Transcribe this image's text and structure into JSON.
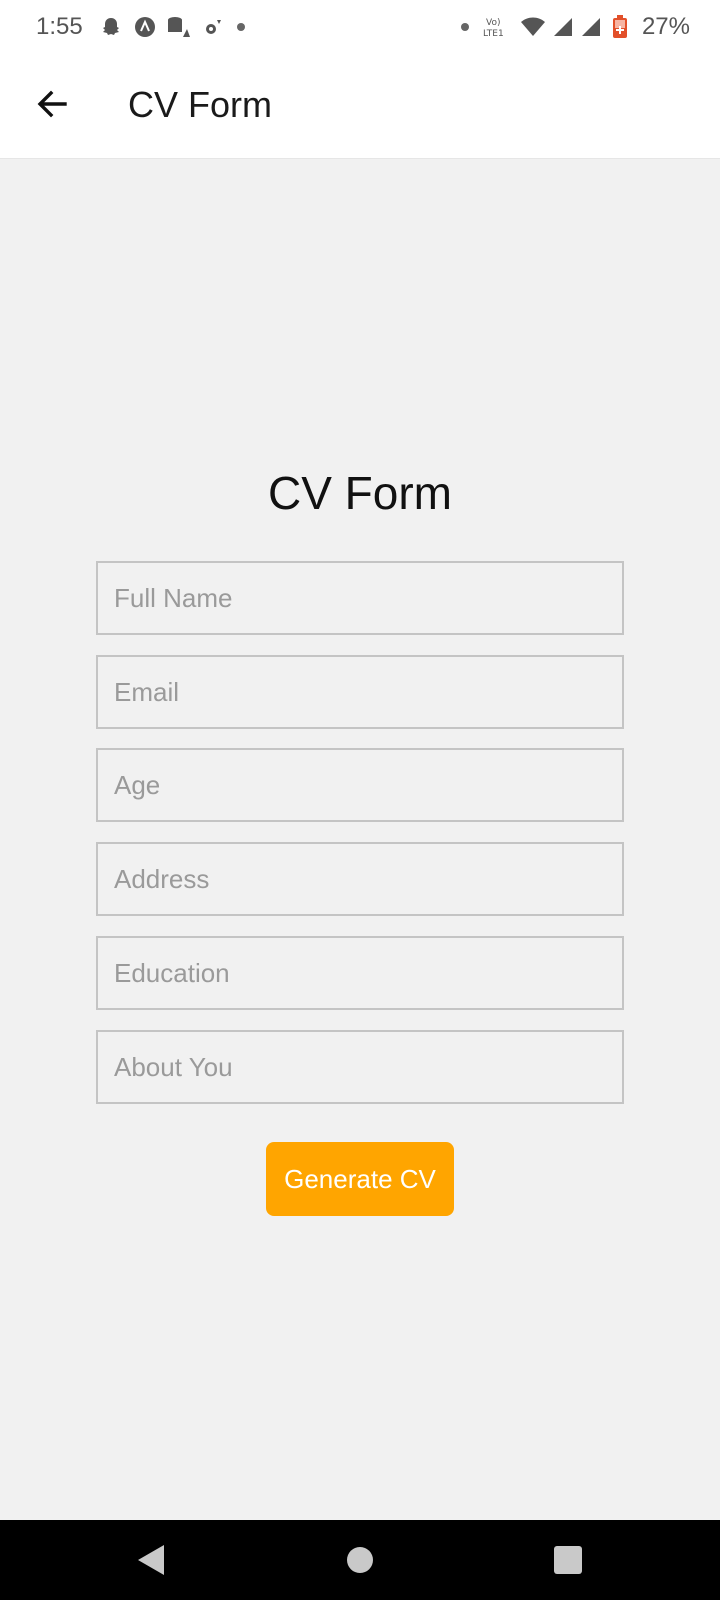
{
  "status_bar": {
    "time": "1:55",
    "battery": "27%",
    "icons": [
      "snapchat-icon",
      "autofill-icon",
      "data-warning-icon",
      "settings-dot-icon",
      "notification-dot-icon",
      "dot-icon",
      "volte-icon",
      "wifi-icon",
      "signal-icon",
      "signal-icon",
      "battery-icon"
    ]
  },
  "app_bar": {
    "title": "CV Form",
    "back_icon": "arrow-back-icon"
  },
  "form": {
    "title": "CV Form",
    "fields": {
      "full_name": {
        "placeholder": "Full Name",
        "value": ""
      },
      "email": {
        "placeholder": "Email",
        "value": ""
      },
      "age": {
        "placeholder": "Age",
        "value": ""
      },
      "address": {
        "placeholder": "Address",
        "value": ""
      },
      "education": {
        "placeholder": "Education",
        "value": ""
      },
      "about": {
        "placeholder": "About You",
        "value": ""
      }
    },
    "submit_label": "Generate CV"
  },
  "colors": {
    "accent": "#ffa500",
    "background": "#f1f1f1",
    "field_border": "#c4c4c4"
  },
  "nav_bar": {
    "icons": [
      "nav-back-icon",
      "nav-home-icon",
      "nav-recents-icon"
    ]
  }
}
